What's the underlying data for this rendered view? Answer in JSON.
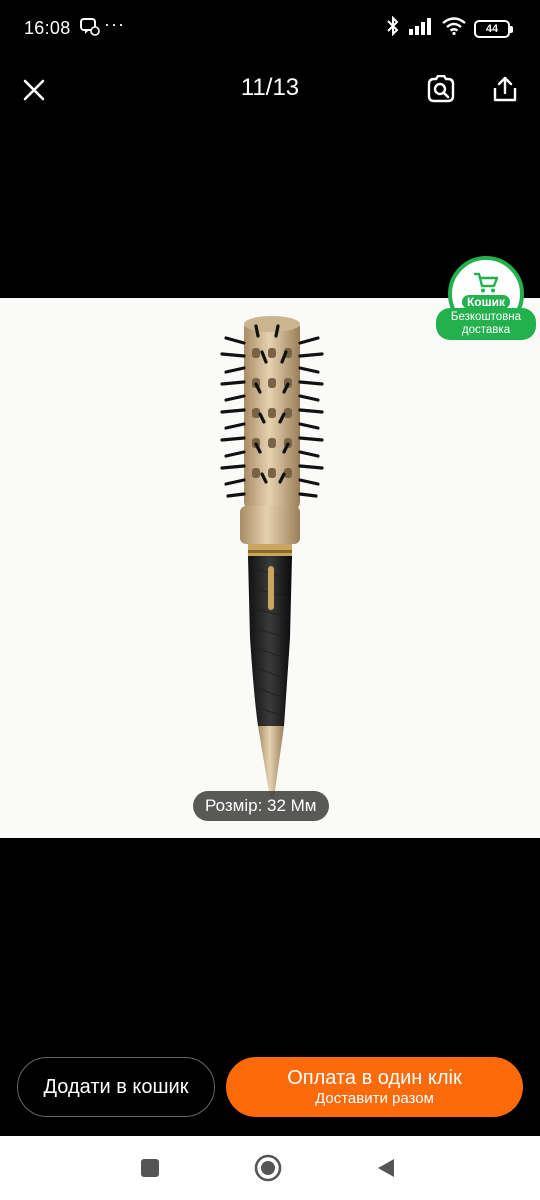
{
  "status_bar": {
    "time": "16:08",
    "more": "···",
    "battery": "44",
    "icons": [
      "notification-icon",
      "bluetooth-icon",
      "signal-icon",
      "wifi-icon",
      "battery-icon"
    ]
  },
  "header": {
    "counter": "11/13",
    "icons": [
      "close-icon",
      "image-search-icon",
      "share-icon"
    ]
  },
  "cart_badge": {
    "label": "Кошик",
    "ribbon_line1": "Безкоштовна",
    "ribbon_line2": "доставка",
    "color": "#23b14d"
  },
  "image": {
    "size_label": "Розмір: 32 Мм"
  },
  "actions": {
    "add_to_cart": "Додати в кошик",
    "pay_main": "Оплата в один клік",
    "pay_sub": "Доставити разом",
    "pay_color": "#fd6a0a"
  },
  "nav": {
    "icons": [
      "recents-icon",
      "home-icon",
      "back-icon"
    ]
  }
}
